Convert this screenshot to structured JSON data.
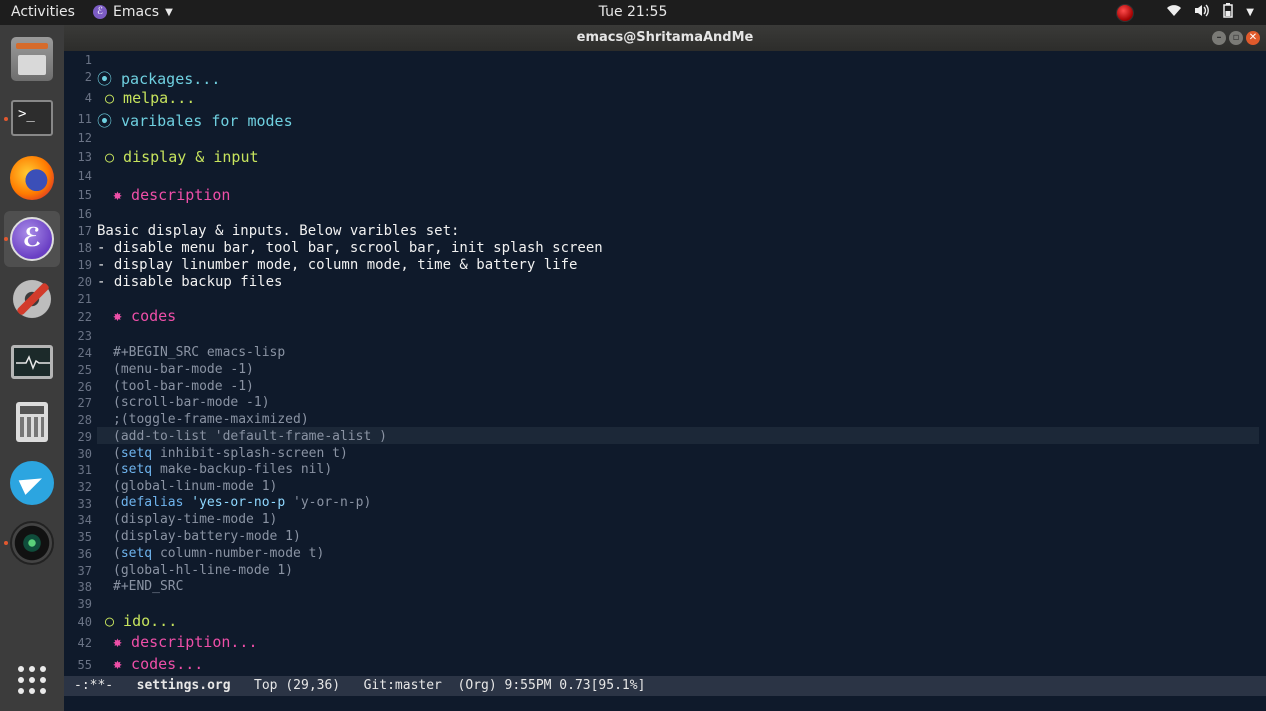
{
  "topbar": {
    "activities": "Activities",
    "app_name": "Emacs",
    "app_icon": "emacs-icon",
    "clock": "Tue 21:55"
  },
  "window": {
    "title": "emacs@ShritamaAndMe"
  },
  "editor": {
    "headings": {
      "packages": "⦿ packages...",
      "melpa": "○ melpa...",
      "variables": "⦿ varibales for modes",
      "display_input": "○ display & input",
      "description": "✸ description",
      "codes": "✸ codes",
      "ido": "○ ido...",
      "description_folded": "✸ description...",
      "codes_folded": "✸ codes..."
    },
    "body": [
      "Basic display & inputs. Below varibles set:",
      "- disable menu bar, tool bar, scrool bar, init splash screen",
      "- display linumber mode, column mode, time & battery life",
      "- disable backup files"
    ],
    "code": {
      "begin": "#+BEGIN_SRC emacs-lisp",
      "l25": "(menu-bar-mode -1)",
      "l26": "(tool-bar-mode -1)",
      "l27": "(scroll-bar-mode -1)",
      "l28": ";(toggle-frame-maximized)",
      "l29": "(add-to-list 'default-frame-alist )",
      "setq": "setq",
      "l30_rest": " inhibit-splash-screen t)",
      "l31_rest": " make-backup-files nil)",
      "l32": "(global-linum-mode 1)",
      "defalias": "defalias",
      "yes_or_no": "'yes-or-no-p",
      "l33_rest": " 'y-or-n-p)",
      "l34": "(display-time-mode 1)",
      "l35": "(display-battery-mode 1)",
      "l36_rest": " column-number-mode t)",
      "l37": "(global-hl-line-mode 1)",
      "end": "#+END_SRC",
      "open_paren": "("
    },
    "line_numbers": [
      "1",
      "2",
      "4",
      "11",
      "12",
      "13",
      "14",
      "15",
      "16",
      "17",
      "18",
      "19",
      "20",
      "21",
      "22",
      "23",
      "24",
      "25",
      "26",
      "27",
      "28",
      "29",
      "30",
      "31",
      "32",
      "33",
      "34",
      "35",
      "36",
      "37",
      "38",
      "39",
      "40",
      "42",
      "55"
    ]
  },
  "modeline": {
    "state": "-:**-",
    "buffer": "settings.org",
    "position": "Top (29,36)",
    "vc": "Git:master",
    "mode": "(Org)",
    "misc": "9:55PM 0.73[95.1%]"
  },
  "dock": {
    "items": [
      "files-icon",
      "terminal-icon",
      "firefox-icon",
      "emacs-icon",
      "settings-icon",
      "system-monitor-icon",
      "calculator-icon",
      "telegram-icon",
      "camera-icon",
      "show-applications-icon"
    ]
  }
}
